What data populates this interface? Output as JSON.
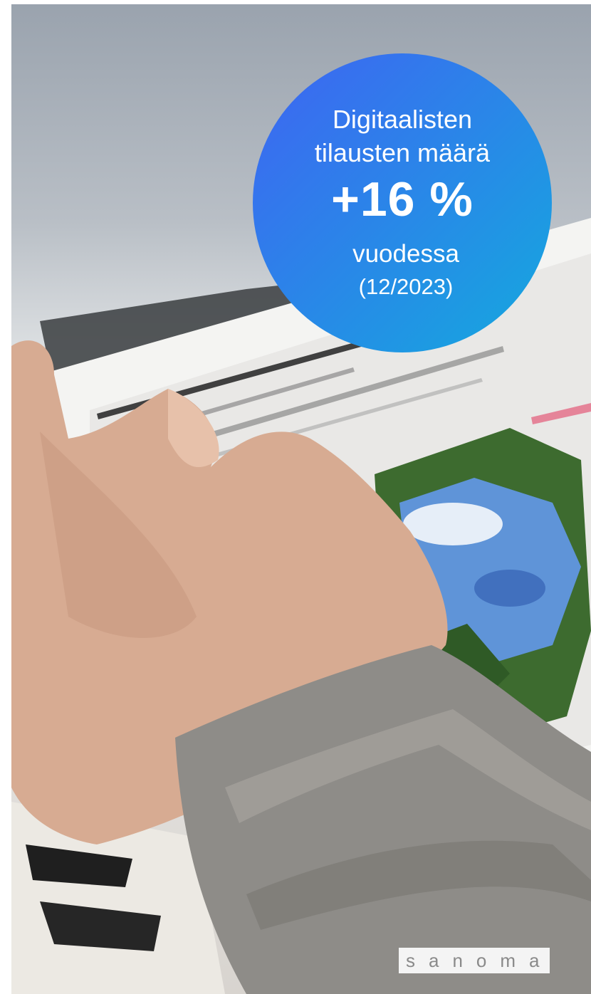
{
  "badge": {
    "line1": "Digitaalisten",
    "line2": "tilausten määrä",
    "value": "+16 %",
    "line4": "vuodessa",
    "line5": "(12/2023)",
    "gradient_colors": [
      "#3f64f2",
      "#14a9de"
    ]
  },
  "logo": {
    "text": "sanoma"
  },
  "photo": {
    "icon": "hand-on-tablet-photo"
  }
}
